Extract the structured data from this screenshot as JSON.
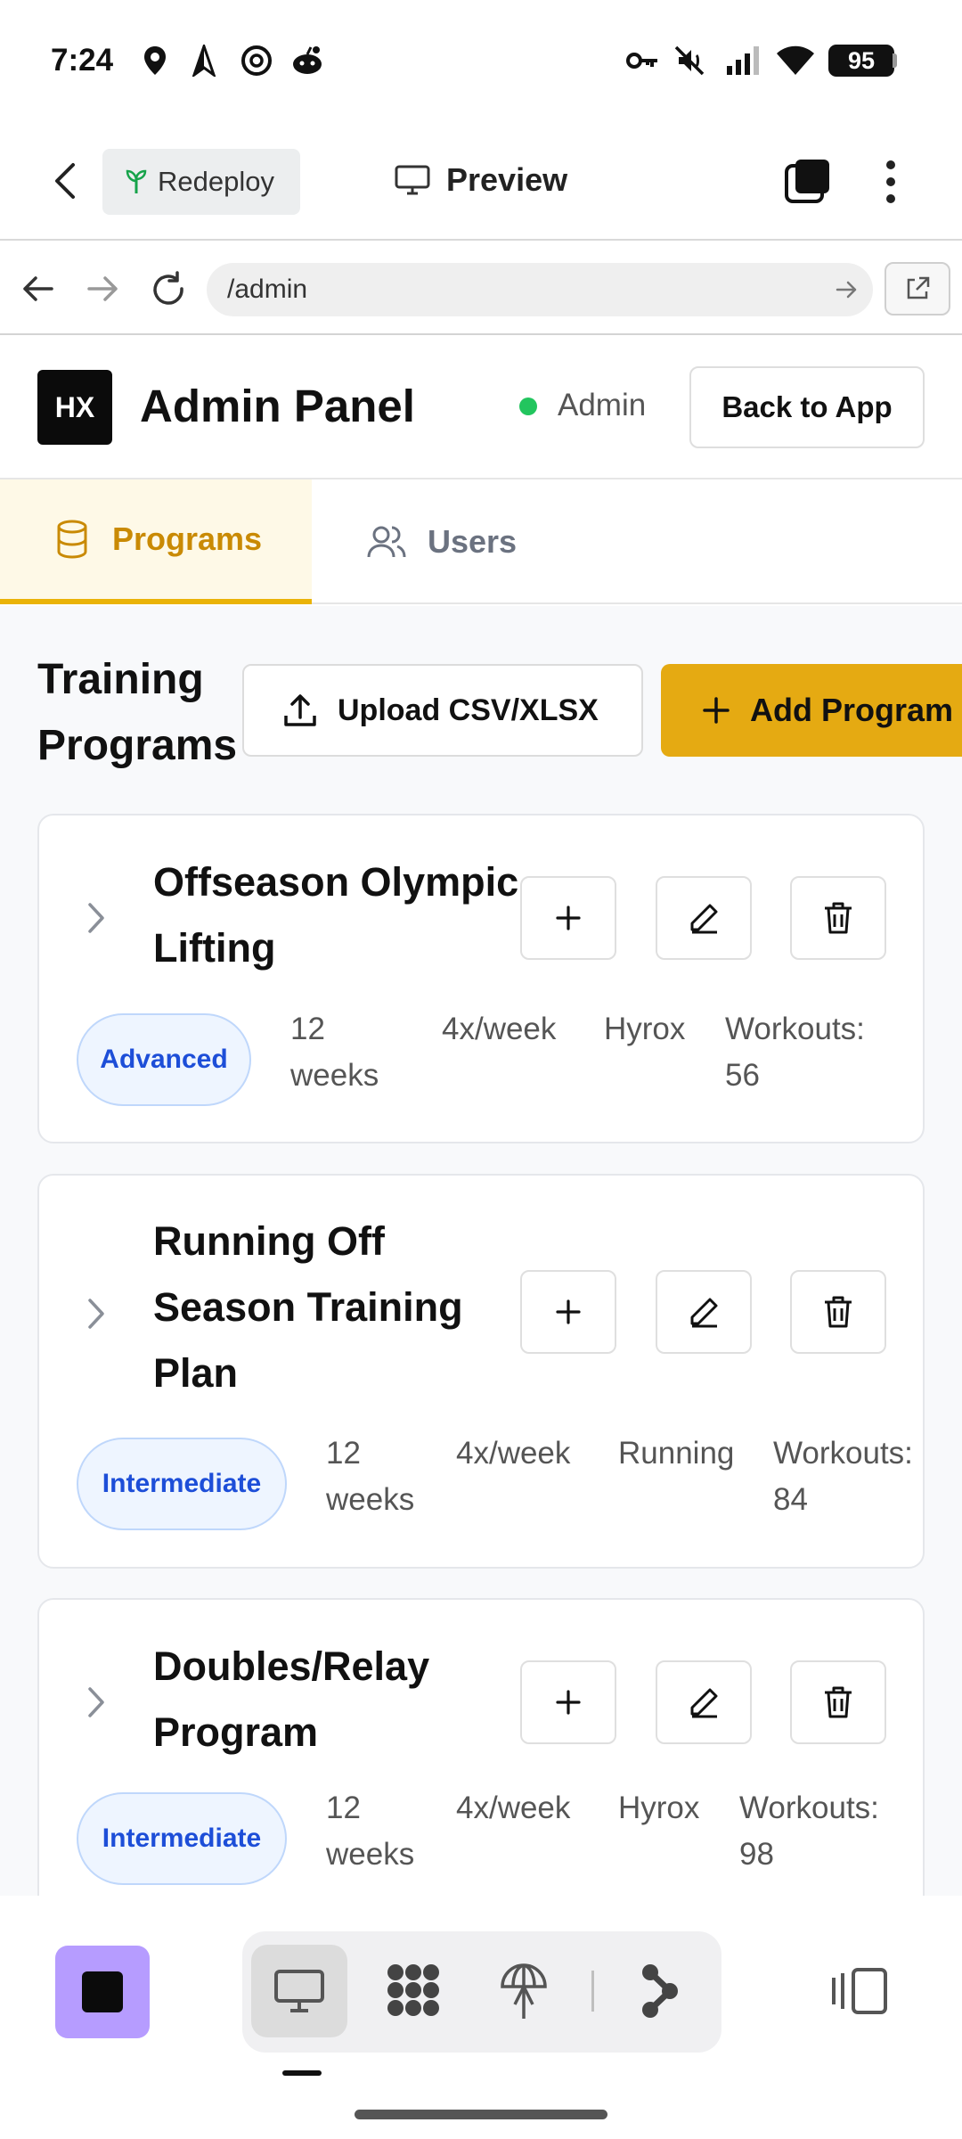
{
  "status_bar": {
    "time": "7:24",
    "battery": "95"
  },
  "top_bar": {
    "redeploy_label": "Redeploy",
    "preview_label": "Preview"
  },
  "url_bar": {
    "url": "/admin"
  },
  "admin_header": {
    "logo": "HX",
    "title": "Admin Panel",
    "role": "Admin",
    "back_label": "Back to App",
    "status_color": "#22c55e"
  },
  "tabs": [
    {
      "label": "Programs",
      "active": true
    },
    {
      "label": "Users",
      "active": false
    }
  ],
  "main": {
    "title": "Training Programs",
    "upload_label": "Upload CSV/XLSX",
    "add_label": "Add Program",
    "accent_color": "#e5aa12"
  },
  "programs": [
    {
      "title": "Offseason Olympic Lifting",
      "level": "Advanced",
      "duration": "12 weeks",
      "frequency": "4x/week",
      "category": "Hyrox",
      "workouts": "Workouts: 56"
    },
    {
      "title": "Running Off Season Training Plan",
      "level": "Intermediate",
      "duration": "12 weeks",
      "frequency": "4x/week",
      "category": "Running",
      "workouts": "Workouts: 84"
    },
    {
      "title": "Doubles/Relay Program",
      "level": "Intermediate",
      "duration": "12 weeks",
      "frequency": "4x/week",
      "category": "Hyrox",
      "workouts": "Workouts: 98"
    }
  ],
  "icons": [
    "location-icon",
    "navigation-icon",
    "threads-icon",
    "reddit-icon",
    "key-icon",
    "mute-icon",
    "signal-icon",
    "wifi-icon",
    "back-icon",
    "sprout-icon",
    "monitor-icon",
    "tabs-icon",
    "more-icon",
    "forward-icon",
    "refresh-icon",
    "external-link-icon",
    "database-icon",
    "users-icon",
    "upload-icon",
    "plus-icon",
    "chevron-right-icon",
    "pencil-icon",
    "trash-icon",
    "grid-icon",
    "globe-icon",
    "share-icon",
    "panel-icon"
  ]
}
